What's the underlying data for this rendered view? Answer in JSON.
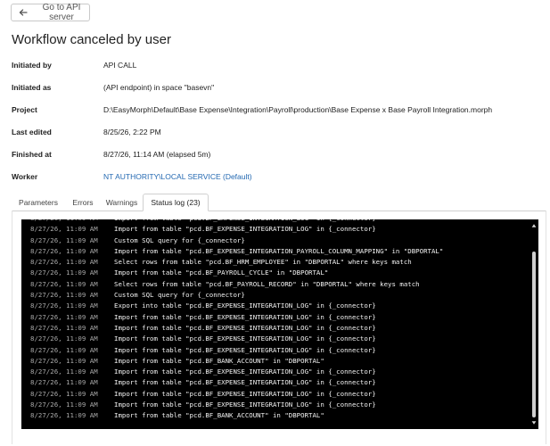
{
  "header": {
    "back_label": "Go to API server",
    "title": "Workflow canceled by user"
  },
  "details": [
    {
      "label": "Initiated by",
      "value": "API CALL"
    },
    {
      "label": "Initiated as",
      "value": "(API endpoint) in space \"basevn\""
    },
    {
      "label": "Project",
      "value": "D:\\EasyMorph\\Default\\Base Expense\\Integration\\Payroll\\production\\Base Expense x Base Payroll Integration.morph"
    },
    {
      "label": "Last edited",
      "value": "8/25/26, 2:22 PM"
    },
    {
      "label": "Finished at",
      "value": "8/27/26, 11:14 AM (elapsed 5m)"
    },
    {
      "label": "Worker",
      "value": "NT AUTHORITY\\LOCAL SERVICE (Default)"
    }
  ],
  "tabs": [
    {
      "label": "Parameters",
      "active": false
    },
    {
      "label": "Errors",
      "active": false
    },
    {
      "label": "Warnings",
      "active": false
    },
    {
      "label": "Status log (23)",
      "active": true
    }
  ],
  "log": [
    {
      "time": "8/27/26, 11:09 AM",
      "message": "Import from table \"pcd.BF_EXPENSE_INTEGRATION_LOG\" in {_connector}"
    },
    {
      "time": "8/27/26, 11:09 AM",
      "message": "Import from table \"pcd.BF_EXPENSE_INTEGRATION_LOG\" in {_connector}"
    },
    {
      "time": "8/27/26, 11:09 AM",
      "message": "Custom SQL query for {_connector}"
    },
    {
      "time": "8/27/26, 11:09 AM",
      "message": "Import from table \"pcd.BF_EXPENSE_INTEGRATION_PAYROLL_COLUMN_MAPPING\" in \"DBPORTAL\""
    },
    {
      "time": "8/27/26, 11:09 AM",
      "message": "Select rows from table \"pcd.BF_HRM_EMPLOYEE\" in \"DBPORTAL\" where keys match"
    },
    {
      "time": "8/27/26, 11:09 AM",
      "message": "Import from table \"pcd.BF_PAYROLL_CYCLE\" in \"DBPORTAL\""
    },
    {
      "time": "8/27/26, 11:09 AM",
      "message": "Select rows from table \"pcd.BF_PAYROLL_RECORD\" in \"DBPORTAL\" where keys match"
    },
    {
      "time": "8/27/26, 11:09 AM",
      "message": "Custom SQL query for {_connector}"
    },
    {
      "time": "8/27/26, 11:09 AM",
      "message": "Export into table \"pcd.BF_EXPENSE_INTEGRATION_LOG\" in {_connector}"
    },
    {
      "time": "8/27/26, 11:09 AM",
      "message": "Import from table \"pcd.BF_EXPENSE_INTEGRATION_LOG\" in {_connector}"
    },
    {
      "time": "8/27/26, 11:09 AM",
      "message": "Import from table \"pcd.BF_EXPENSE_INTEGRATION_LOG\" in {_connector}"
    },
    {
      "time": "8/27/26, 11:09 AM",
      "message": "Import from table \"pcd.BF_EXPENSE_INTEGRATION_LOG\" in {_connector}"
    },
    {
      "time": "8/27/26, 11:09 AM",
      "message": "Import from table \"pcd.BF_EXPENSE_INTEGRATION_LOG\" in {_connector}"
    },
    {
      "time": "8/27/26, 11:09 AM",
      "message": "Import from table \"pcd.BF_BANK_ACCOUNT\" in \"DBPORTAL\""
    },
    {
      "time": "8/27/26, 11:09 AM",
      "message": "Import from table \"pcd.BF_EXPENSE_INTEGRATION_LOG\" in {_connector}"
    },
    {
      "time": "8/27/26, 11:09 AM",
      "message": "Import from table \"pcd.BF_EXPENSE_INTEGRATION_LOG\" in {_connector}"
    },
    {
      "time": "8/27/26, 11:09 AM",
      "message": "Import from table \"pcd.BF_EXPENSE_INTEGRATION_LOG\" in {_connector}"
    },
    {
      "time": "8/27/26, 11:09 AM",
      "message": "Import from table \"pcd.BF_EXPENSE_INTEGRATION_LOG\" in {_connector}"
    },
    {
      "time": "8/27/26, 11:09 AM",
      "message": "Import from table \"pcd.BF_BANK_ACCOUNT\" in \"DBPORTAL\""
    }
  ],
  "icons": {
    "back": "arrow-left-icon",
    "scroll_up": "triangle-up-icon",
    "scroll_down": "triangle-down-icon"
  },
  "colors": {
    "link": "#2469b2",
    "log_background": "#000000",
    "log_timestamp": "#a9a9a9",
    "log_text": "#f2f2f2"
  }
}
